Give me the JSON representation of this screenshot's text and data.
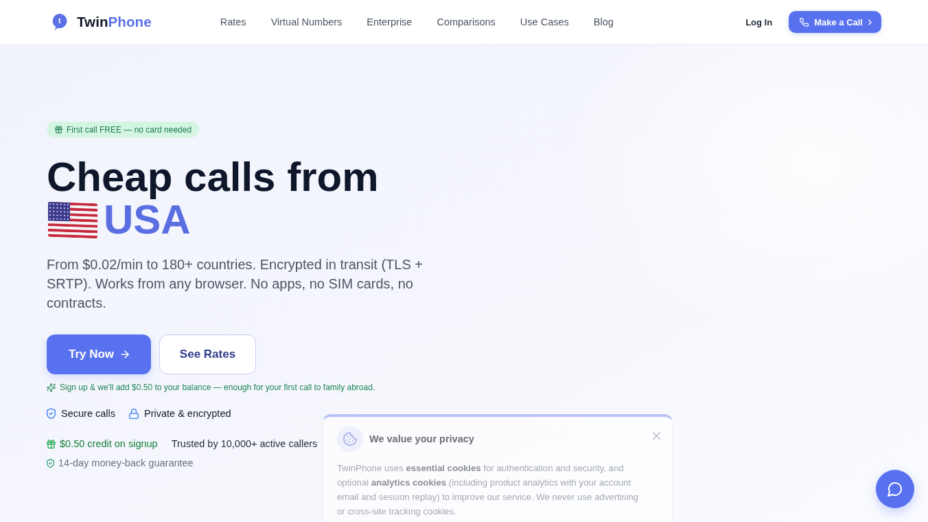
{
  "nav": {
    "logo": {
      "mark_letter": "t",
      "name": "Twin",
      "accent": "Phone"
    },
    "links": [
      {
        "label": "Rates"
      },
      {
        "label": "Virtual Numbers"
      },
      {
        "label": "Enterprise"
      },
      {
        "label": "Comparisons"
      },
      {
        "label": "Use Cases"
      },
      {
        "label": "Blog"
      }
    ],
    "login": "Log In",
    "cta": "Make a Call"
  },
  "hero": {
    "badge": "First call FREE — no card needed",
    "title": "Cheap calls from",
    "country": "USA",
    "description": "From $0.02/min to 180+ countries. Encrypted in transit (TLS + SRTP). Works from any browser. No apps, no SIM cards, no contracts.",
    "buttons": [
      {
        "kind": "primary",
        "label": "Try Now"
      },
      {
        "kind": "secondary",
        "label": "See Rates"
      }
    ],
    "bonus_note": "Sign up & we'll add $0.50 to your balance — enough for your first call to family abroad.",
    "features": [
      {
        "kind": "shield",
        "label": "Secure calls"
      },
      {
        "kind": "lock",
        "label": "Private & encrypted"
      }
    ],
    "trust": [
      {
        "kind": "credit",
        "label": "$0.50 credit on signup"
      },
      {
        "kind": "stat",
        "label": "Trusted by 10,000+ active callers"
      }
    ],
    "guarantee": "14-day money-back guarantee"
  },
  "cookie_banner": {
    "title": "We value your privacy",
    "body": "TwinPhone uses **essential cookies** for authentication and security, and optional **analytics cookies** (including product analytics with your account email and session replay) to improve our service. We never use advertising or cross-site tracking cookies."
  }
}
